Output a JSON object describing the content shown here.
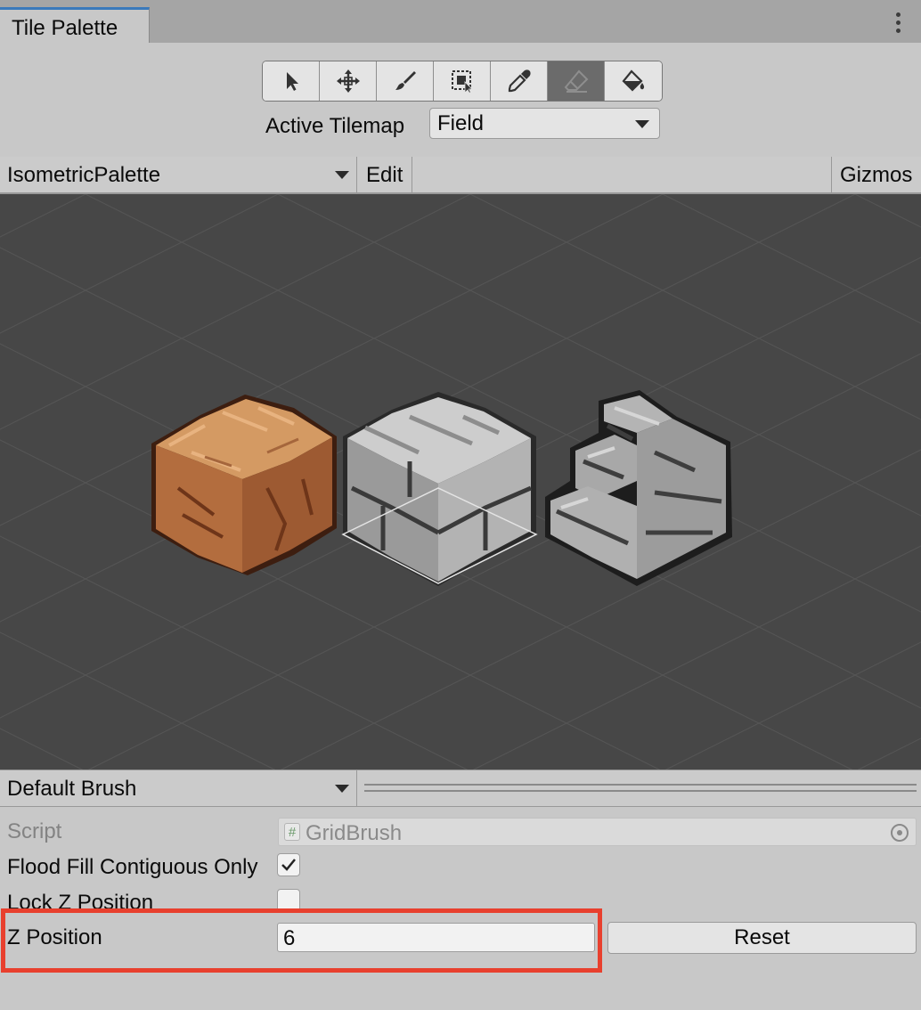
{
  "window": {
    "tab_title": "Tile Palette",
    "menu_icon": "kebab-menu-icon"
  },
  "toolbar": {
    "tools": [
      {
        "name": "select",
        "icon": "arrow-cursor-icon",
        "active": false
      },
      {
        "name": "move",
        "icon": "move-arrows-icon",
        "active": false
      },
      {
        "name": "paint",
        "icon": "paintbrush-icon",
        "active": false
      },
      {
        "name": "box-fill",
        "icon": "box-fill-icon",
        "active": false
      },
      {
        "name": "pick",
        "icon": "eyedropper-icon",
        "active": false
      },
      {
        "name": "erase",
        "icon": "eraser-icon",
        "active": true
      },
      {
        "name": "flood-fill",
        "icon": "paint-bucket-icon",
        "active": false
      }
    ],
    "active_tilemap_label": "Active Tilemap",
    "active_tilemap_value": "Field"
  },
  "palette": {
    "selected": "IsometricPalette",
    "edit_label": "Edit",
    "gizmos_label": "Gizmos",
    "tiles": [
      "dirt-block",
      "stone-block",
      "stone-stairs"
    ]
  },
  "brush": {
    "selected": "Default Brush",
    "script_label": "Script",
    "script_value": "GridBrush",
    "flood_fill_label": "Flood Fill Contiguous Only",
    "flood_fill_checked": true,
    "lock_z_label": "Lock Z Position",
    "lock_z_checked": false,
    "z_position_label": "Z Position",
    "z_position_value": "6",
    "reset_label": "Reset"
  },
  "colors": {
    "highlight": "#e8402e",
    "tab_accent": "#3a79bb",
    "canvas_bg": "#474747"
  }
}
